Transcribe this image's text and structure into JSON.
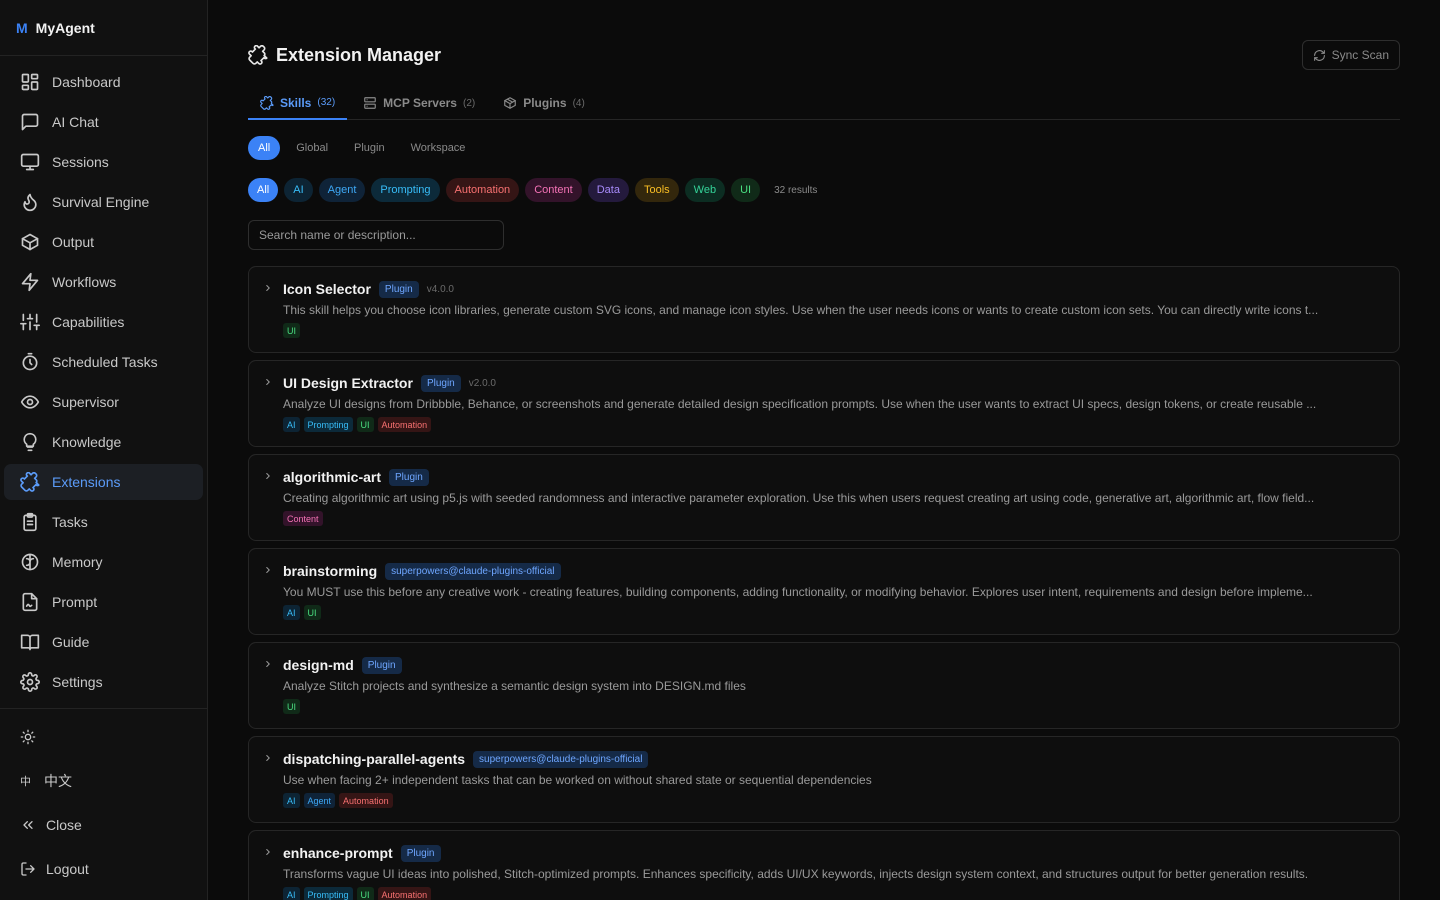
{
  "brand": {
    "mark": "M",
    "name": "MyAgent"
  },
  "sidebar": {
    "items": [
      {
        "label": "Dashboard",
        "icon": "dashboard-icon"
      },
      {
        "label": "AI Chat",
        "icon": "chat-icon"
      },
      {
        "label": "Sessions",
        "icon": "monitor-icon"
      },
      {
        "label": "Survival Engine",
        "icon": "flame-icon"
      },
      {
        "label": "Output",
        "icon": "box-icon"
      },
      {
        "label": "Workflows",
        "icon": "bolt-icon"
      },
      {
        "label": "Capabilities",
        "icon": "sliders-icon"
      },
      {
        "label": "Scheduled Tasks",
        "icon": "timer-icon"
      },
      {
        "label": "Supervisor",
        "icon": "eye-icon"
      },
      {
        "label": "Knowledge",
        "icon": "lightbulb-icon"
      },
      {
        "label": "Extensions",
        "icon": "puzzle-icon",
        "active": true
      },
      {
        "label": "Tasks",
        "icon": "clipboard-icon"
      },
      {
        "label": "Memory",
        "icon": "brain-icon"
      },
      {
        "label": "Prompt",
        "icon": "file-signature-icon"
      },
      {
        "label": "Guide",
        "icon": "book-icon"
      },
      {
        "label": "Settings",
        "icon": "gear-icon"
      }
    ],
    "footer": {
      "theme_icon": "sun-icon",
      "language": "中文",
      "language_icon": "translate-icon",
      "close": "Close",
      "logout": "Logout"
    }
  },
  "header": {
    "title": "Extension Manager",
    "sync_label": "Sync Scan"
  },
  "tabs": [
    {
      "label": "Skills",
      "count": "(32)",
      "icon": "puzzle-icon",
      "active": true
    },
    {
      "label": "MCP Servers",
      "count": "(2)",
      "icon": "server-icon"
    },
    {
      "label": "Plugins",
      "count": "(4)",
      "icon": "package-icon"
    }
  ],
  "scopes": [
    "All",
    "Global",
    "Plugin",
    "Workspace"
  ],
  "categories": [
    {
      "label": "All",
      "active": true
    },
    {
      "label": "AI",
      "color": "#38bdf8",
      "bg": "#0d2434"
    },
    {
      "label": "Agent",
      "color": "#3ea8f5",
      "bg": "#0f2338"
    },
    {
      "label": "Prompting",
      "color": "#38bdf8",
      "bg": "#0c2a3a"
    },
    {
      "label": "Automation",
      "color": "#f87171",
      "bg": "#351515"
    },
    {
      "label": "Content",
      "color": "#f472b6",
      "bg": "#33132a"
    },
    {
      "label": "Data",
      "color": "#a78bfa",
      "bg": "#241a3d"
    },
    {
      "label": "Tools",
      "color": "#fbbf24",
      "bg": "#33270c"
    },
    {
      "label": "Web",
      "color": "#34d399",
      "bg": "#0c2d22"
    },
    {
      "label": "UI",
      "color": "#4ade80",
      "bg": "#102a18"
    }
  ],
  "results": "32 results",
  "search": {
    "placeholder": "Search name or description..."
  },
  "tag_colors": {
    "AI": {
      "color": "#38bdf8",
      "bg": "#0d2434"
    },
    "Agent": {
      "color": "#3ea8f5",
      "bg": "#0f2338"
    },
    "Prompting": {
      "color": "#38bdf8",
      "bg": "#0c2a3a"
    },
    "Automation": {
      "color": "#f87171",
      "bg": "#351515"
    },
    "Content": {
      "color": "#f472b6",
      "bg": "#33132a"
    },
    "UI": {
      "color": "#4ade80",
      "bg": "#102a18"
    }
  },
  "skills": [
    {
      "name": "Icon Selector",
      "source": "Plugin",
      "version": "v4.0.0",
      "description": "This skill helps you choose icon libraries, generate custom SVG icons, and manage icon styles. Use when the user needs icons or wants to create custom icon sets. You can directly write icons t...",
      "tags": [
        "UI"
      ]
    },
    {
      "name": "UI Design Extractor",
      "source": "Plugin",
      "version": "v2.0.0",
      "description": "Analyze UI designs from Dribbble, Behance, or screenshots and generate detailed design specification prompts. Use when the user wants to extract UI specs, design tokens, or create reusable ...",
      "tags": [
        "AI",
        "Prompting",
        "UI",
        "Automation"
      ]
    },
    {
      "name": "algorithmic-art",
      "source": "Plugin",
      "version": "",
      "description": "Creating algorithmic art using p5.js with seeded randomness and interactive parameter exploration. Use this when users request creating art using code, generative art, algorithmic art, flow field...",
      "tags": [
        "Content"
      ]
    },
    {
      "name": "brainstorming",
      "source": "superpowers@claude-plugins-official",
      "version": "",
      "description": "You MUST use this before any creative work - creating features, building components, adding functionality, or modifying behavior. Explores user intent, requirements and design before impleme...",
      "tags": [
        "AI",
        "UI"
      ]
    },
    {
      "name": "design-md",
      "source": "Plugin",
      "version": "",
      "description": "Analyze Stitch projects and synthesize a semantic design system into DESIGN.md files",
      "tags": [
        "UI"
      ]
    },
    {
      "name": "dispatching-parallel-agents",
      "source": "superpowers@claude-plugins-official",
      "version": "",
      "description": "Use when facing 2+ independent tasks that can be worked on without shared state or sequential dependencies",
      "tags": [
        "AI",
        "Agent",
        "Automation"
      ]
    },
    {
      "name": "enhance-prompt",
      "source": "Plugin",
      "version": "",
      "description": "Transforms vague UI ideas into polished, Stitch-optimized prompts. Enhances specificity, adds UI/UX keywords, injects design system context, and structures output for better generation results.",
      "tags": [
        "AI",
        "Prompting",
        "UI",
        "Automation"
      ]
    }
  ]
}
